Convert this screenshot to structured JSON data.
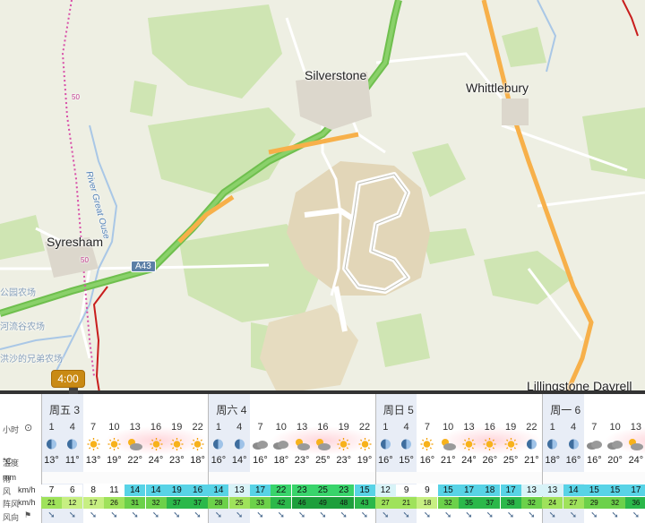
{
  "map": {
    "places": [
      "Silverstone",
      "Whittlebury",
      "Syresham",
      "Lillingstone Dayrell"
    ],
    "river": "River Great Ouse",
    "road_a43": "A43",
    "path_50_top": "50",
    "path_50_left": "50",
    "faded_labels": [
      "公园农场",
      "河流谷农场",
      "洪沙的兄弟农场"
    ]
  },
  "timeline": {
    "badge": "4:00"
  },
  "labels": {
    "hour": "小时",
    "temp": "温度",
    "temp_unit": "°C",
    "rain": "雨",
    "rain_unit": "mm",
    "wind": "风",
    "wind_unit": "km/h",
    "gust": "阵风",
    "gust_unit": "km/h",
    "dir": "风向"
  },
  "days": [
    "周五 3",
    "周六 4",
    "周日 5",
    "周一 6"
  ],
  "hours": [
    "1",
    "4",
    "7",
    "10",
    "13",
    "16",
    "19",
    "22",
    "1",
    "4",
    "7",
    "10",
    "13",
    "16",
    "19",
    "22",
    "1",
    "4",
    "7",
    "10",
    "13",
    "16",
    "19",
    "22",
    "1",
    "4",
    "7",
    "10",
    "13"
  ],
  "icons": [
    "moon",
    "moon",
    "sun",
    "sun",
    "suncloud",
    "sun",
    "sun",
    "sun",
    "moon",
    "moon",
    "cloud",
    "cloud",
    "suncloud",
    "suncloud",
    "sun",
    "sun",
    "moon",
    "moon",
    "sun",
    "suncloud",
    "sun",
    "sun",
    "sun",
    "moon",
    "moon",
    "moon",
    "cloud",
    "cloud",
    "suncloud"
  ],
  "temps": [
    "13°",
    "11°",
    "13°",
    "19°",
    "22°",
    "24°",
    "23°",
    "18°",
    "16°",
    "14°",
    "16°",
    "18°",
    "23°",
    "25°",
    "23°",
    "19°",
    "16°",
    "15°",
    "16°",
    "21°",
    "24°",
    "26°",
    "25°",
    "21°",
    "18°",
    "16°",
    "16°",
    "20°",
    "24°"
  ],
  "wind": [
    7,
    6,
    8,
    11,
    14,
    14,
    19,
    16,
    14,
    13,
    17,
    22,
    23,
    25,
    23,
    15,
    12,
    9,
    9,
    15,
    17,
    18,
    17,
    13,
    13,
    14,
    15,
    15,
    17
  ],
  "gust": [
    21,
    12,
    17,
    26,
    31,
    32,
    37,
    37,
    28,
    25,
    33,
    42,
    46,
    49,
    48,
    43,
    27,
    21,
    18,
    32,
    35,
    37,
    38,
    32,
    24,
    27,
    29,
    32,
    36
  ],
  "colors": {
    "wind_scale": {
      "low": "#ffffff",
      "mid": "#5fd5e8",
      "high": "#38d36a"
    },
    "gust_scale": {
      "a": "#c6ee7a",
      "b": "#8fde4c",
      "c": "#33c24e",
      "d": "#23ab42"
    }
  }
}
